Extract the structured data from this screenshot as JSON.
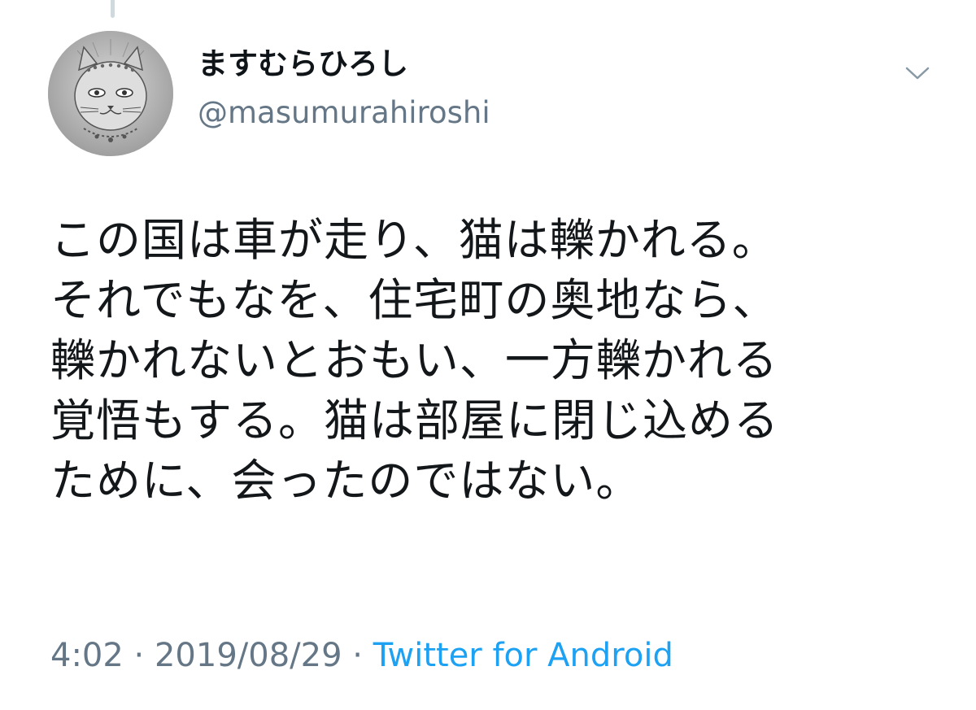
{
  "author": {
    "display_name": "ますむらひろし",
    "handle": "@masumurahiroshi",
    "avatar_icon": "cat-avatar-icon"
  },
  "menu": {
    "icon": "chevron-down-icon"
  },
  "tweet": {
    "lines": [
      "この国は車が走り、猫は轢かれる。",
      "それでもなを、住宅町の奥地なら、",
      "轢かれないとおもい、一方轢かれる",
      "覚悟もする。猫は部屋に閉じ込める",
      "ために、会ったのではない。"
    ]
  },
  "meta": {
    "time": "4:02",
    "separator": "·",
    "date": "2019/08/29",
    "source": "Twitter for Android"
  },
  "colors": {
    "text": "#14171a",
    "secondary": "#657786",
    "link": "#1da1f2"
  }
}
